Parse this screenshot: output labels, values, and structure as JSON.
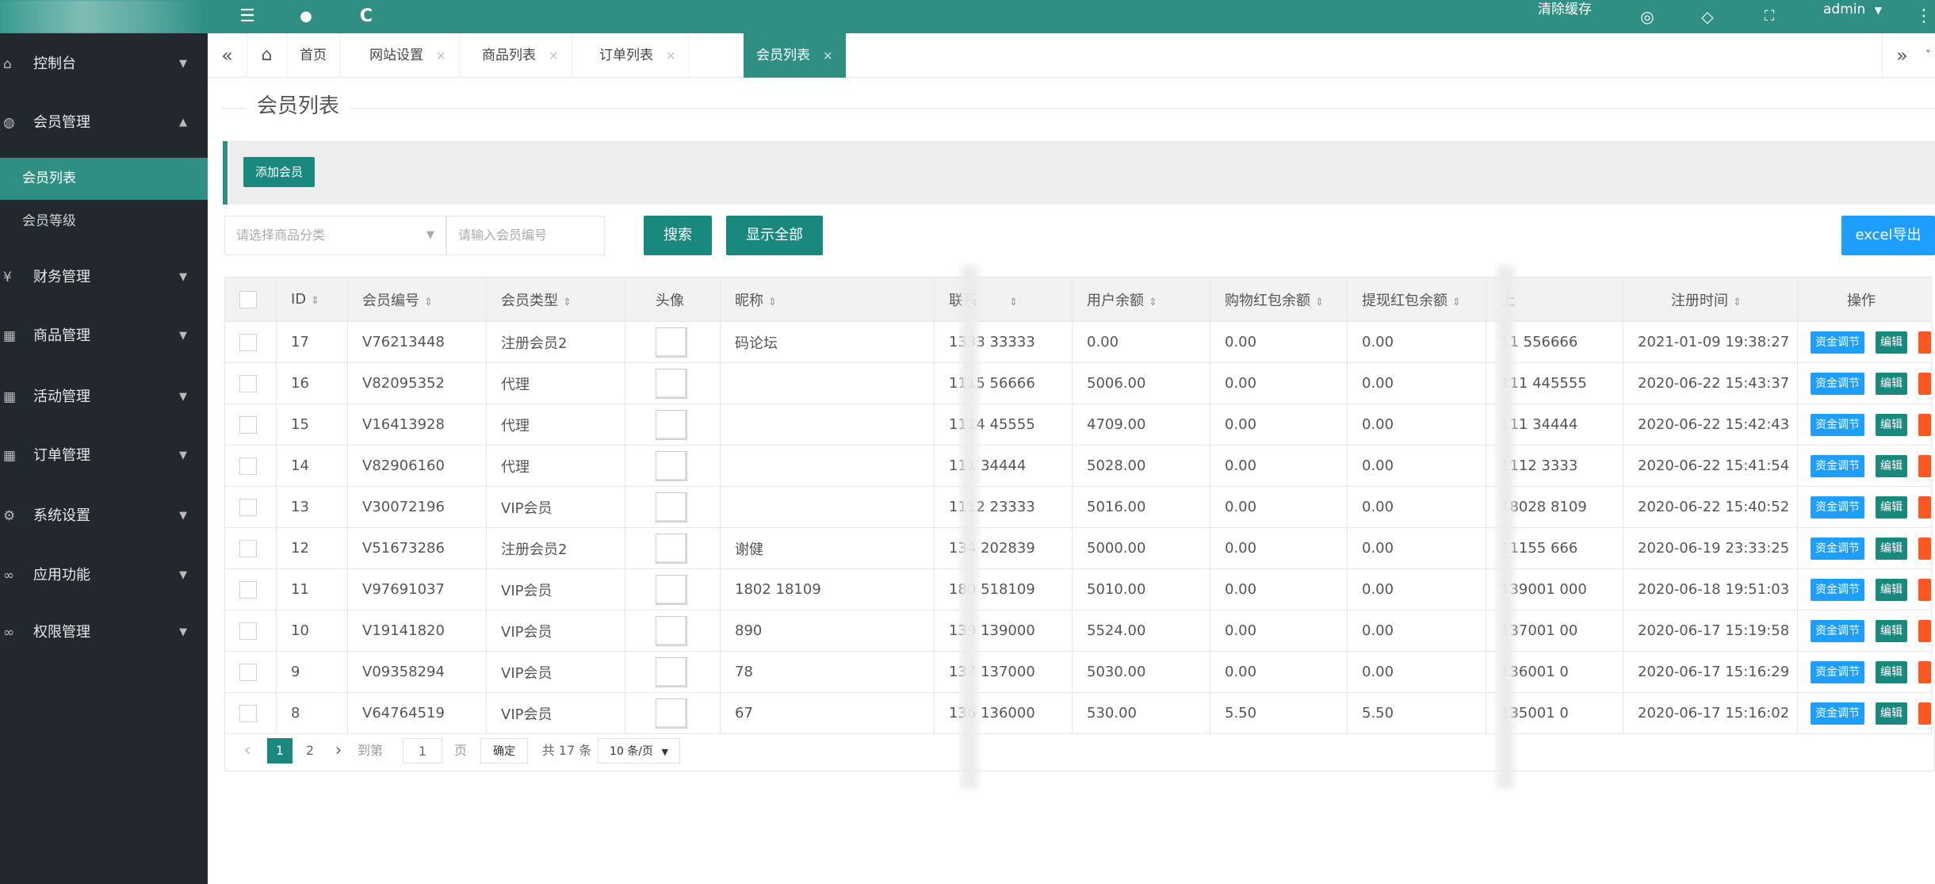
{
  "topbar": {
    "clear_cache": "清除缓存",
    "user": "admin",
    "user_caret": "▼",
    "menu_icon": "☰",
    "globe_icon": "●",
    "refresh_icon": "C",
    "palette_icon": "◎",
    "tag_icon": "◇",
    "fullscreen_icon": "⛶",
    "more_icon": "⋮"
  },
  "sidebar": {
    "items": [
      {
        "label": "控制台",
        "icon": "⌂",
        "arrow": "▼"
      },
      {
        "label": "会员管理",
        "icon": "◍",
        "arrow": "▲"
      },
      {
        "label": "财务管理",
        "icon": "¥",
        "arrow": "▼"
      },
      {
        "label": "商品管理",
        "icon": "▦",
        "arrow": "▼"
      },
      {
        "label": "活动管理",
        "icon": "▦",
        "arrow": "▼"
      },
      {
        "label": "订单管理",
        "icon": "▦",
        "arrow": "▼"
      },
      {
        "label": "系统设置",
        "icon": "⚙",
        "arrow": "▼"
      },
      {
        "label": "应用功能",
        "icon": "∞",
        "arrow": "▼"
      },
      {
        "label": "权限管理",
        "icon": "∞",
        "arrow": "▼"
      }
    ],
    "sub_items": [
      {
        "label": "会员列表"
      },
      {
        "label": "会员等级"
      }
    ]
  },
  "tabs": {
    "prev_icon": "«",
    "next_icon": "»",
    "home_icon": "⌂",
    "down_icon": "˅",
    "close": "×",
    "items": [
      {
        "label": "首页"
      },
      {
        "label": "网站设置"
      },
      {
        "label": "商品列表"
      },
      {
        "label": "订单列表"
      },
      {
        "label": "会员列表"
      }
    ]
  },
  "page": {
    "title": "会员列表",
    "add_button": "添加会员",
    "category_placeholder": "请选择商品分类",
    "member_no_placeholder": "请输入会员编号",
    "search_button": "搜索",
    "show_all_button": "显示全部",
    "export_button": "excel导出"
  },
  "table": {
    "headers": [
      "ID",
      "会员编号",
      "会员类型",
      "头像",
      "昵称",
      "联系",
      "用户余额",
      "购物红包余额",
      "提现红包余额",
      "上",
      "注册时间",
      "操作"
    ],
    "sort_icon": "⇕",
    "action_fund": "资金调节",
    "action_edit": "编辑",
    "rows": [
      {
        "id": "17",
        "no": "V76213448",
        "type": "注册会员2",
        "nick": "码论坛",
        "phone": "1333 33333",
        "balance": "0.00",
        "shop": "0.00",
        "withdraw": "0.00",
        "parent": "11 556666",
        "time": "2021-01-09 19:38:27"
      },
      {
        "id": "16",
        "no": "V82095352",
        "type": "代理",
        "nick": "",
        "phone": "1115 56666",
        "balance": "5006.00",
        "shop": "0.00",
        "withdraw": "0.00",
        "parent": "111 445555",
        "time": "2020-06-22 15:43:37"
      },
      {
        "id": "15",
        "no": "V16413928",
        "type": "代理",
        "nick": "",
        "phone": "1114 45555",
        "balance": "4709.00",
        "shop": "0.00",
        "withdraw": "0.00",
        "parent": "111 34444",
        "time": "2020-06-22 15:42:43"
      },
      {
        "id": "14",
        "no": "V82906160",
        "type": "代理",
        "nick": "",
        "phone": "111 34444",
        "balance": "5028.00",
        "shop": "0.00",
        "withdraw": "0.00",
        "parent": "1112 3333",
        "time": "2020-06-22 15:41:54"
      },
      {
        "id": "13",
        "no": "V30072196",
        "type": "VIP会员",
        "nick": "",
        "phone": "1112 23333",
        "balance": "5016.00",
        "shop": "0.00",
        "withdraw": "0.00",
        "parent": "18028 8109",
        "time": "2020-06-22 15:40:52"
      },
      {
        "id": "12",
        "no": "V51673286",
        "type": "注册会员2",
        "nick": "谢健",
        "phone": "134 202839",
        "balance": "5000.00",
        "shop": "0.00",
        "withdraw": "0.00",
        "parent": "11155 666",
        "time": "2020-06-19 23:33:25"
      },
      {
        "id": "11",
        "no": "V97691037",
        "type": "VIP会员",
        "nick": "1802 18109",
        "phone": "180 518109",
        "balance": "5010.00",
        "shop": "0.00",
        "withdraw": "0.00",
        "parent": "139001 000",
        "time": "2020-06-18 19:51:03"
      },
      {
        "id": "10",
        "no": "V19141820",
        "type": "VIP会员",
        "nick": "890",
        "phone": "139 139000",
        "balance": "5524.00",
        "shop": "0.00",
        "withdraw": "0.00",
        "parent": "137001 00",
        "time": "2020-06-17 15:19:58"
      },
      {
        "id": "9",
        "no": "V09358294",
        "type": "VIP会员",
        "nick": "78",
        "phone": "137 137000",
        "balance": "5030.00",
        "shop": "0.00",
        "withdraw": "0.00",
        "parent": "136001 0",
        "time": "2020-06-17 15:16:29"
      },
      {
        "id": "8",
        "no": "V64764519",
        "type": "VIP会员",
        "nick": "67",
        "phone": "136 136000",
        "balance": "530.00",
        "shop": "5.50",
        "withdraw": "5.50",
        "parent": "135001 0",
        "time": "2020-06-17 15:16:02"
      }
    ]
  },
  "pager": {
    "prev": "‹",
    "next": "›",
    "page1": "1",
    "page2": "2",
    "goto_label": "到第",
    "goto_value": "1",
    "page_unit": "页",
    "confirm": "确定",
    "total": "共 17 条",
    "per_page": "10 条/页",
    "per_page_caret": "▼"
  }
}
